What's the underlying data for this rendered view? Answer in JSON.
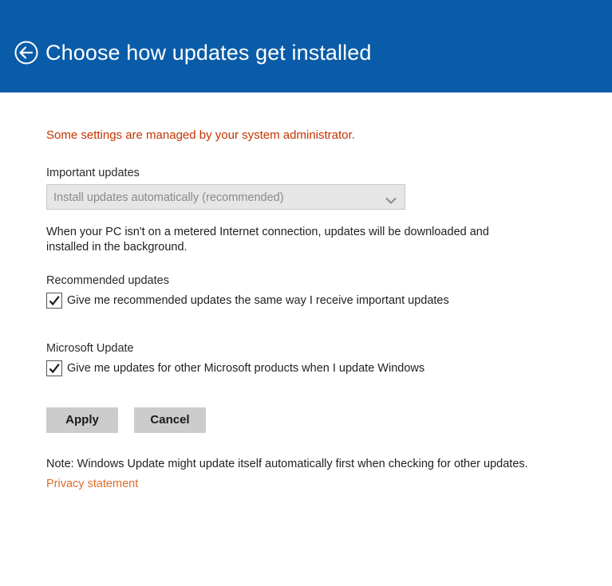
{
  "header": {
    "title": "Choose how updates get installed",
    "back_icon": "back-arrow-circle-icon",
    "background_color": "#0b5ca8"
  },
  "admin_notice": "Some settings are managed by your system administrator.",
  "important_updates": {
    "label": "Important updates",
    "selected_value": "Install updates automatically (recommended)",
    "disabled": true,
    "chevron_icon": "chevron-down-icon"
  },
  "description": "When your PC isn't on a metered Internet connection, updates will be downloaded and installed in the background.",
  "recommended_updates": {
    "label": "Recommended updates",
    "checkbox_label": "Give me recommended updates the same way I receive important updates",
    "checked": true
  },
  "microsoft_update": {
    "label": "Microsoft Update",
    "checkbox_label": "Give me updates for other Microsoft products when I update Windows",
    "checked": true
  },
  "buttons": {
    "apply": "Apply",
    "cancel": "Cancel"
  },
  "note": "Note: Windows Update might update itself automatically first when checking for other updates.",
  "privacy_link": "Privacy statement",
  "colors": {
    "accent": "#0b5ca8",
    "warning": "#c33400",
    "link": "#e06d2b"
  }
}
